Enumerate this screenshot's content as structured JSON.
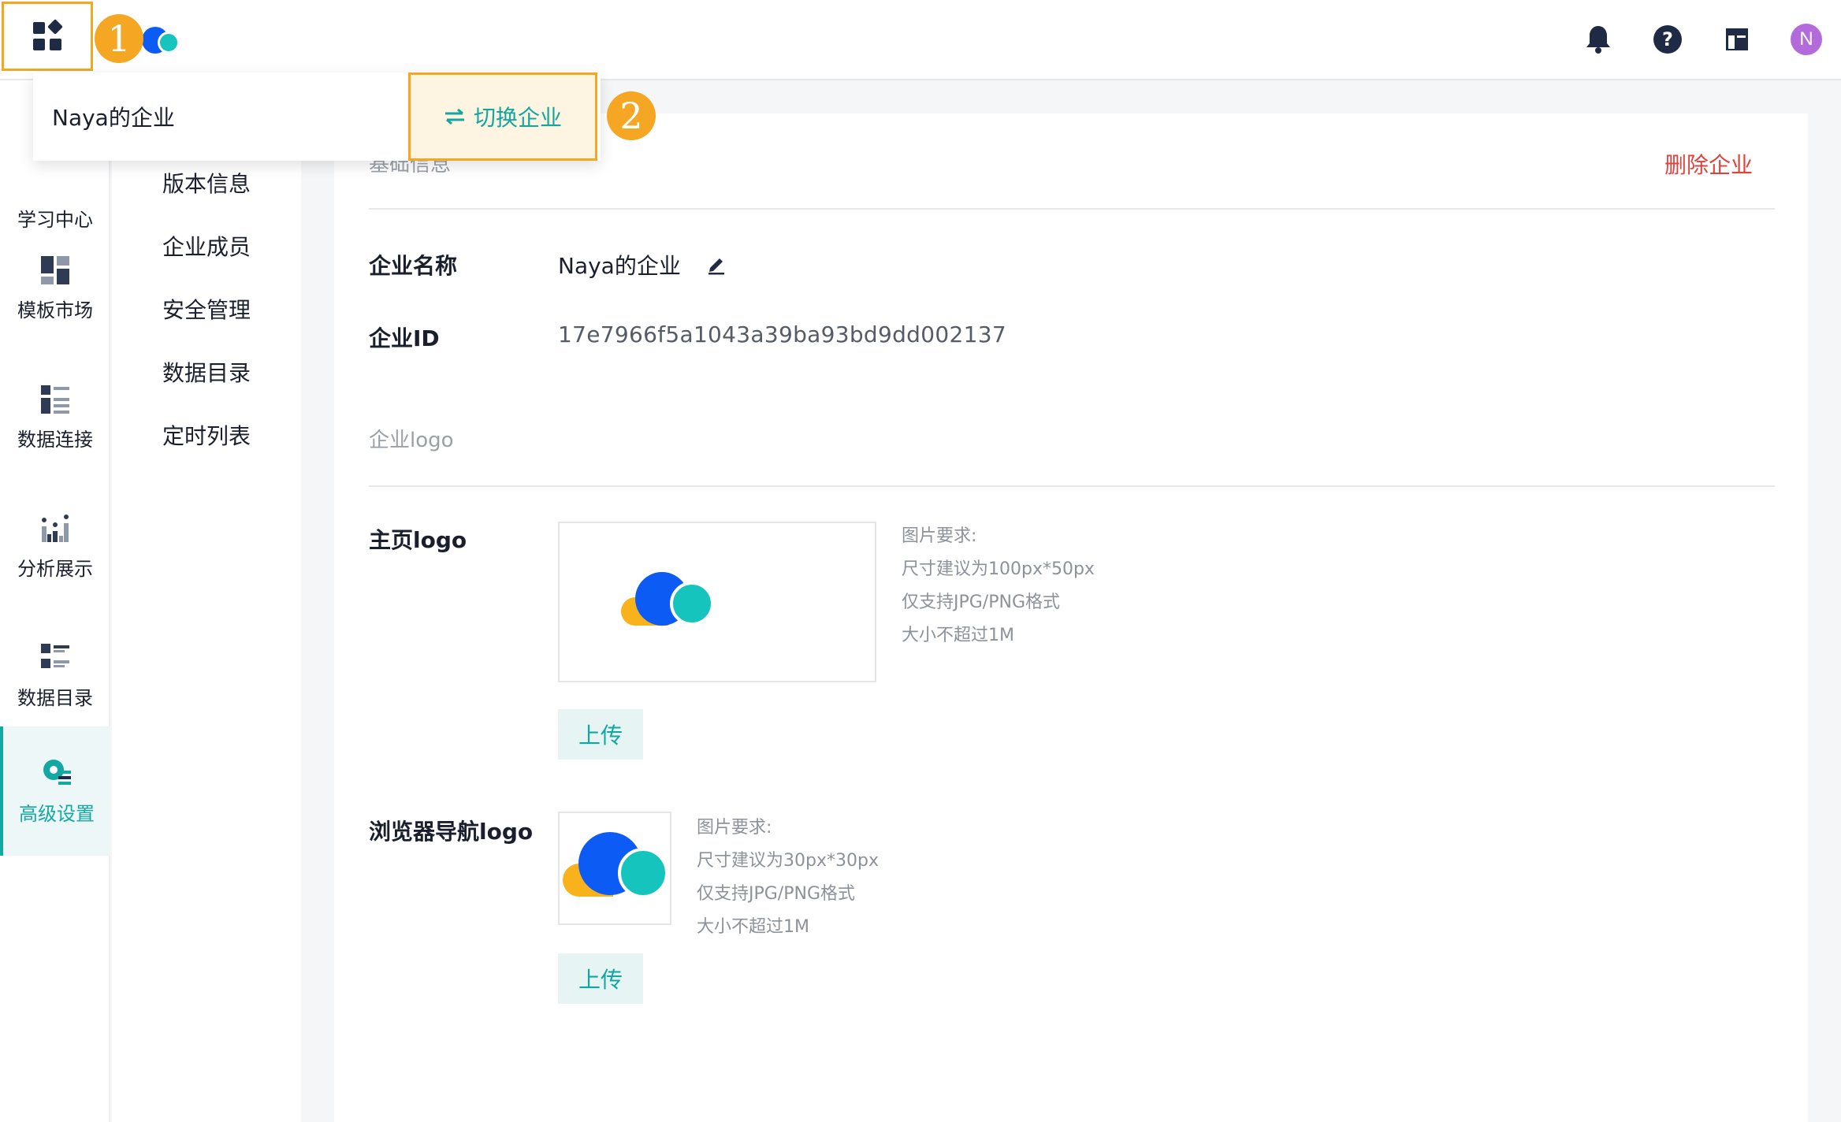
{
  "header": {
    "apps_icon": "apps-grid-icon",
    "step_1": "1",
    "notification_icon": "bell-icon",
    "help_icon": "help-icon",
    "layout_icon": "layout-icon",
    "avatar_letter": "N"
  },
  "dropdown": {
    "enterprise_name": "Naya的企业",
    "switch_label": "切换企业",
    "switch_icon": "swap-arrows-icon",
    "step_2": "2"
  },
  "leftnav": {
    "items": [
      {
        "label": "学习中心",
        "icon": "learning-icon"
      },
      {
        "label": "模板市场",
        "icon": "template-market-icon"
      },
      {
        "label": "数据连接",
        "icon": "data-connection-icon"
      },
      {
        "label": "分析展示",
        "icon": "analysis-icon"
      },
      {
        "label": "数据目录",
        "icon": "data-catalog-icon"
      },
      {
        "label": "高级设置",
        "icon": "advanced-settings-icon"
      }
    ]
  },
  "subnav": {
    "items": [
      "版本信息",
      "企业成员",
      "安全管理",
      "数据目录",
      "定时列表"
    ]
  },
  "main": {
    "section_basic": "基础信息",
    "delete_label": "删除企业",
    "name_label": "企业名称",
    "name_value": "Naya的企业",
    "id_label": "企业ID",
    "id_value": "17e7966f5a1043a39ba93bd9dd002137",
    "section_logo": "企业logo",
    "home_logo_label": "主页logo",
    "home_req": [
      "图片要求:",
      "尺寸建议为100px*50px",
      "仅支持JPG/PNG格式",
      "大小不超过1M"
    ],
    "browser_logo_label": "浏览器导航logo",
    "browser_req": [
      "图片要求:",
      "尺寸建议为30px*30px",
      "仅支持JPG/PNG格式",
      "大小不超过1M"
    ],
    "upload_label": "上传"
  },
  "colors": {
    "accent": "#14a8a3",
    "highlight": "#f5a623",
    "danger": "#e0413a",
    "logo_blue": "#0d5bf5",
    "logo_teal": "#14c4bd",
    "logo_yellow": "#f8b21c"
  }
}
